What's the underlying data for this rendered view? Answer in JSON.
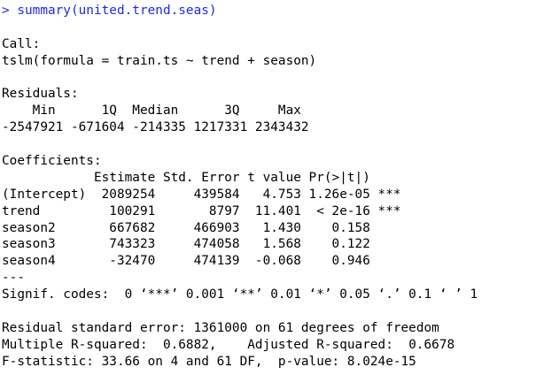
{
  "console": {
    "command": "> summary(united.trend.seas)",
    "output": [
      "",
      "Call:",
      "tslm(formula = train.ts ~ trend + season)",
      "",
      "Residuals:",
      "    Min      1Q  Median      3Q     Max ",
      "-2547921 -671604 -214335 1217331 2343432 ",
      "",
      "Coefficients:",
      "            Estimate Std. Error t value Pr(>|t|)    ",
      "(Intercept)  2089254     439584   4.753 1.26e-05 ***",
      "trend         100291       8797  11.401  < 2e-16 ***",
      "season2       667682     466903   1.430    0.158    ",
      "season3       743323     474058   1.568    0.122    ",
      "season4       -32470     474139  -0.068    0.946    ",
      "---",
      "Signif. codes:  0 ‘***’ 0.001 ‘**’ 0.01 ‘*’ 0.05 ‘.’ 0.1 ‘ ’ 1",
      "",
      "Residual standard error: 1361000 on 61 degrees of freedom",
      "Multiple R-squared:  0.6882,\tAdjusted R-squared:  0.6678 ",
      "F-statistic: 33.66 on 4 and 61 DF,  p-value: 8.024e-15"
    ],
    "colors": {
      "command": "#1f28e6",
      "output": "#000000",
      "background": "#ffffff"
    }
  }
}
